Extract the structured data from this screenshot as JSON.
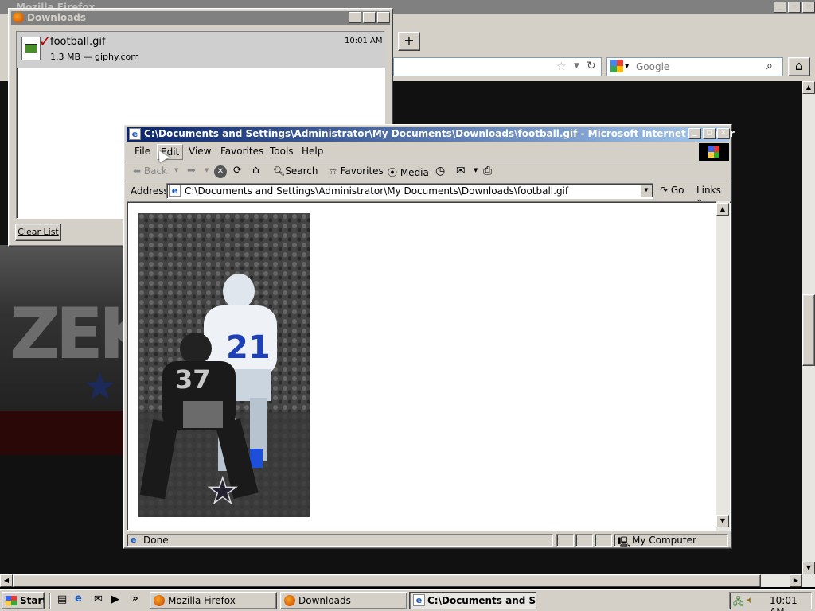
{
  "firefox": {
    "title": "Mozilla Firefox",
    "search_placeholder": "Google",
    "new_tab": "+"
  },
  "downloads": {
    "title": "Downloads",
    "items": [
      {
        "name": "football.gif",
        "meta": "1.3 MB — giphy.com",
        "time": "10:01 AM"
      }
    ],
    "clear_label": "Clear List"
  },
  "ie": {
    "title": "C:\\Documents and Settings\\Administrator\\My Documents\\Downloads\\football.gif - Microsoft Internet Explorer",
    "menu": [
      "File",
      "Edit",
      "View",
      "Favorites",
      "Tools",
      "Help"
    ],
    "toolbar": {
      "back": "Back",
      "search": "Search",
      "favorites": "Favorites",
      "media": "Media"
    },
    "address_label": "Address",
    "address_value": "C:\\Documents and Settings\\Administrator\\My Documents\\Downloads\\football.gif",
    "go_label": "Go",
    "links_label": "Links",
    "status": "Done",
    "zone": "My Computer"
  },
  "image": {
    "jersey_front": "21",
    "jersey_back": "37"
  },
  "background_art": {
    "text": "ZEK"
  },
  "taskbar": {
    "start": "Start",
    "tasks": [
      "Mozilla Firefox",
      "Downloads",
      "C:\\Documents and S..."
    ],
    "clock": "10:01 AM"
  }
}
